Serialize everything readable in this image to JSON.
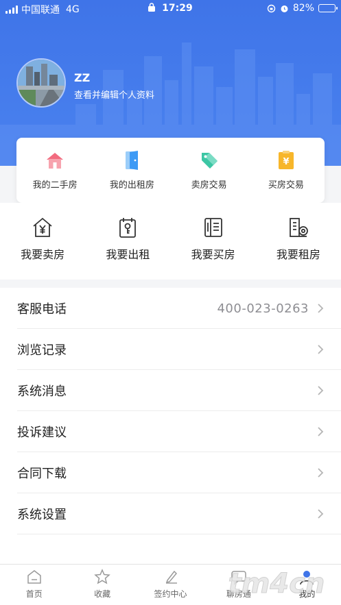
{
  "status_bar": {
    "carrier": "中国联通",
    "network": "4G",
    "time": "17:29",
    "battery": "82%",
    "battery_level": 0.82
  },
  "profile": {
    "name": "ZZ",
    "subtitle": "查看并编辑个人资料",
    "avatar_icon": "city-photo"
  },
  "quick_card": [
    {
      "label": "我的二手房",
      "icon": "house-icon",
      "color": "#f26b7f"
    },
    {
      "label": "我的出租房",
      "icon": "door-icon",
      "color": "#3d9af5"
    },
    {
      "label": "卖房交易",
      "icon": "tag-icon",
      "color": "#3cc6a4"
    },
    {
      "label": "买房交易",
      "icon": "clipboard-yen-icon",
      "color": "#f7b62a"
    }
  ],
  "actions": [
    {
      "label": "我要卖房",
      "icon": "house-yen-icon"
    },
    {
      "label": "我要出租",
      "icon": "rent-key-icon"
    },
    {
      "label": "我要买房",
      "icon": "property-doc-icon"
    },
    {
      "label": "我要租房",
      "icon": "building-key-icon"
    }
  ],
  "menu": [
    {
      "label": "客服电话",
      "value": "400-023-0263"
    },
    {
      "label": "浏览记录",
      "value": ""
    },
    {
      "label": "系统消息",
      "value": ""
    },
    {
      "label": "投诉建议",
      "value": ""
    },
    {
      "label": "合同下载",
      "value": ""
    },
    {
      "label": "系统设置",
      "value": ""
    }
  ],
  "tabbar": [
    {
      "label": "首页",
      "icon": "home-icon",
      "active": false
    },
    {
      "label": "收藏",
      "icon": "star-icon",
      "active": false
    },
    {
      "label": "签约中心",
      "icon": "pen-icon",
      "active": false
    },
    {
      "label": "聊房通",
      "icon": "chat-icon",
      "active": false
    },
    {
      "label": "我的",
      "icon": "profile-icon",
      "active": true
    }
  ],
  "watermark": {
    "text": "tm4cn"
  },
  "colors": {
    "header": "#4a80ee",
    "accent": "#3f74e8"
  }
}
